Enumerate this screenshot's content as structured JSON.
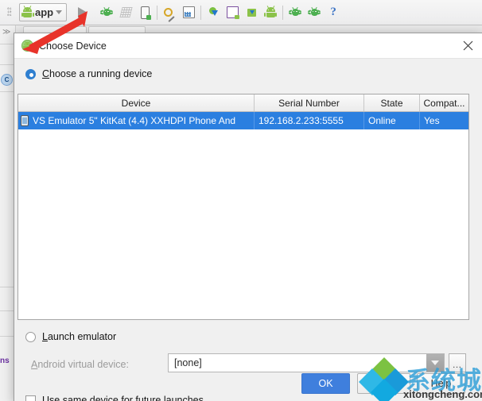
{
  "ide": {
    "toolbar": {
      "binary_icon_lines": [
        "01",
        "10",
        "01"
      ],
      "run_config_label": "app",
      "icons": [
        {
          "name": "binary-code-icon"
        },
        {
          "name": "run-configuration-dropdown"
        },
        {
          "name": "run-icon"
        },
        {
          "name": "debug-icon"
        },
        {
          "name": "coverage-icon"
        },
        {
          "name": "attach-debugger-icon"
        },
        {
          "name": "project-structure-icon"
        },
        {
          "name": "layout-inspector-icon"
        },
        {
          "name": "sync-gradle-icon"
        },
        {
          "name": "device-monitor-icon"
        },
        {
          "name": "sdk-manager-icon"
        },
        {
          "name": "avd-manager-icon"
        },
        {
          "name": "android-device-monitor-icon"
        },
        {
          "name": "ddms-icon"
        },
        {
          "name": "help-icon"
        }
      ],
      "help_glyph": "?"
    },
    "left_gutter": {
      "chevron": "≫",
      "class_icon": "C",
      "code_fragment": "ns"
    }
  },
  "dialog": {
    "title": "Choose Device",
    "title_icon": "android-icon",
    "close_label": "×",
    "running_device": {
      "radio_label": "Choose a running device",
      "radio_mnemonic": "C",
      "radio_label_rest": "hoose a running device",
      "selected": true
    },
    "table": {
      "columns": [
        "Device",
        "Serial Number",
        "State",
        "Compat..."
      ],
      "rows": [
        {
          "device": "VS Emulator 5\" KitKat (4.4) XXHDPI Phone And",
          "serial": "192.168.2.233:5555",
          "state": "Online",
          "compatible": "Yes",
          "selected": true
        }
      ]
    },
    "launch_emulator": {
      "radio_label": "Launch emulator",
      "radio_mnemonic": "L",
      "radio_label_rest": "aunch emulator",
      "selected": false
    },
    "avd": {
      "label": "Android virtual device:",
      "label_mnemonic": "A",
      "label_rest": "ndroid virtual device:",
      "value": "[none]",
      "ellipsis_label": "…",
      "disabled": true
    },
    "use_same_device": {
      "label": "Use same device for future launches",
      "checked": false
    },
    "buttons": {
      "ok": "OK",
      "cancel": "Cancel",
      "help": "Help"
    }
  },
  "watermark": {
    "site_name_cn": "系统城",
    "url": "xitongcheng.com",
    "logo_colors": {
      "top": "#7cc242",
      "left": "#2fb8e6",
      "right": "#1a9ad9",
      "bottom": "#12a9e0"
    }
  },
  "annotation": {
    "arrow_color": "#e8332a",
    "arrow_description": "red-arrow-pointing-to-dialog"
  },
  "colors": {
    "selection_blue": "#2b7fe0",
    "primary_button": "#3f7fdd",
    "dialog_bg": "#f0f0f0",
    "android_green": "#8bc24a"
  }
}
